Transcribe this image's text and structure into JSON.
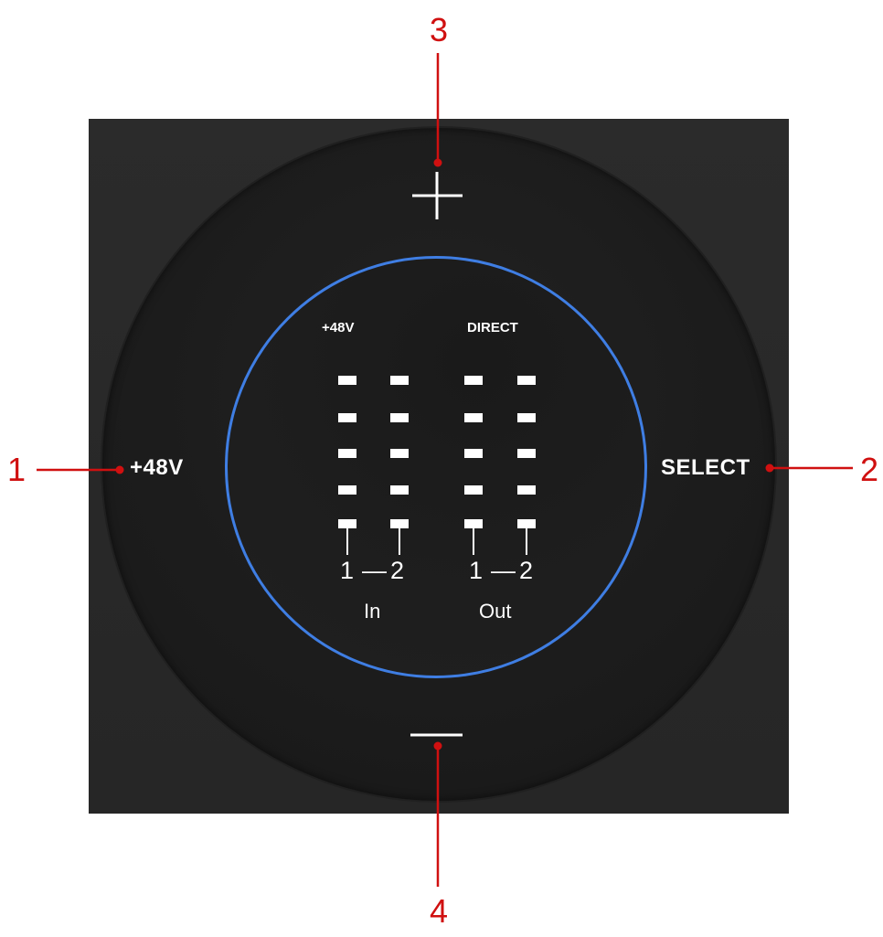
{
  "buttons": {
    "left_label": "+48V",
    "right_label": "SELECT",
    "top_symbol": "plus-icon",
    "bottom_symbol": "minus-icon"
  },
  "ring": {
    "indicator_left": "+48V",
    "indicator_right": "DIRECT",
    "meter_group_left": {
      "channel_a": "1",
      "separator": "—",
      "channel_b": "2",
      "label": "In"
    },
    "meter_group_right": {
      "channel_a": "1",
      "separator": "—",
      "channel_b": "2",
      "label": "Out"
    },
    "segments_per_meter": 5
  },
  "callouts": {
    "c1": "1",
    "c2": "2",
    "c3": "3",
    "c4": "4"
  },
  "colors": {
    "accent_ring": "#3f7ee3",
    "callout": "#d01010",
    "panel": "#2a2a2a"
  }
}
